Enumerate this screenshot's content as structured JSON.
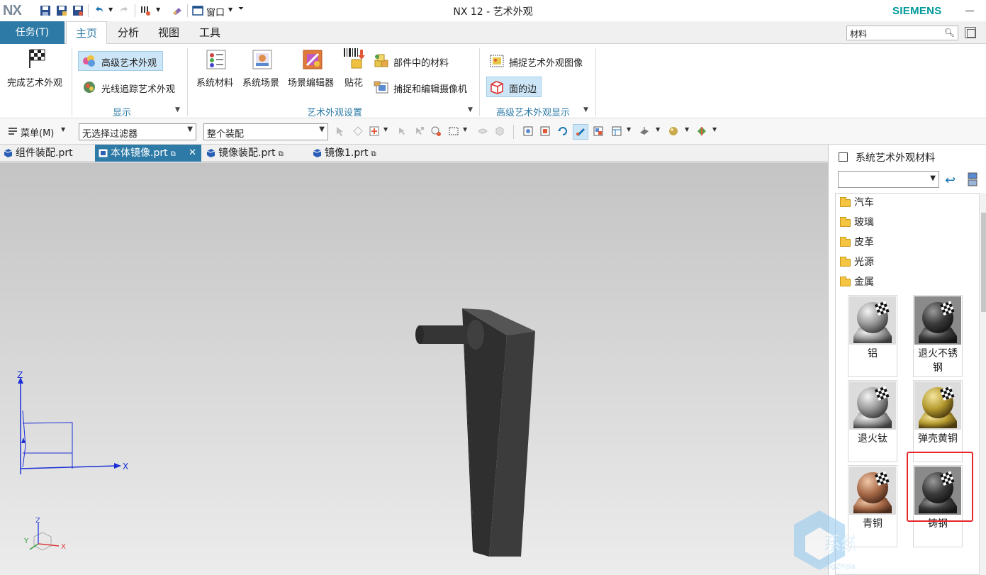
{
  "app": {
    "logo": "NX",
    "title": "NX 12 - 艺术外观",
    "brand": "SIEMENS",
    "window_menu": "窗口",
    "accent": "#2d7aa6",
    "brand_color": "#009999"
  },
  "ribbon_tabs": [
    {
      "label": "任务(T)"
    },
    {
      "label": "主页",
      "selected": true
    },
    {
      "label": "分析"
    },
    {
      "label": "视图"
    },
    {
      "label": "工具"
    }
  ],
  "search": {
    "value": "材料",
    "icon": "search-icon"
  },
  "ribbon": {
    "finish": "完成艺术外观",
    "advanced_studio": "高级艺术外观",
    "ray_trace": "光线追踪艺术外观",
    "group_display": "显示",
    "system_materials": "系统材料",
    "system_scenes": "系统场景",
    "scene_editor": "场景编辑器",
    "decal": "贴花",
    "part_materials": "部件中的材料",
    "capture_camera": "捕捉和编辑摄像机",
    "group_settings": "艺术外观设置",
    "capture_image": "捕捉艺术外观图像",
    "face_edges": "面的边",
    "group_advanced": "高级艺术外观显示"
  },
  "toolbar": {
    "menu": "菜单(M)",
    "filter": "无选择过滤器",
    "scope": "整个装配"
  },
  "file_tabs": [
    {
      "label": "组件装配.prt",
      "active": false
    },
    {
      "label": "本体镜像.prt",
      "active": true
    },
    {
      "label": "镜像装配.prt",
      "active": false
    },
    {
      "label": "镜像1.prt",
      "active": false
    }
  ],
  "viewport": {
    "axis_z": "Z",
    "axis_x": "X",
    "triad_z": "Z",
    "triad_y": "Y",
    "triad_x": "X"
  },
  "panel": {
    "title": "系统艺术外观材料",
    "folders": [
      "汽车",
      "玻璃",
      "皮革",
      "光源",
      "金属"
    ],
    "materials": [
      {
        "name": "铝",
        "tone": "silver"
      },
      {
        "name": "退火不锈钢",
        "tone": "dark"
      },
      {
        "name": "退火钛",
        "tone": "silver"
      },
      {
        "name": "弹壳黄铜",
        "tone": "gold"
      },
      {
        "name": "青铜",
        "tone": "bronze"
      },
      {
        "name": "铸钢",
        "tone": "dark",
        "highlighted": true
      }
    ]
  },
  "watermark": {
    "text": "系统之家",
    "site": "XiTongZhiJia.net"
  }
}
